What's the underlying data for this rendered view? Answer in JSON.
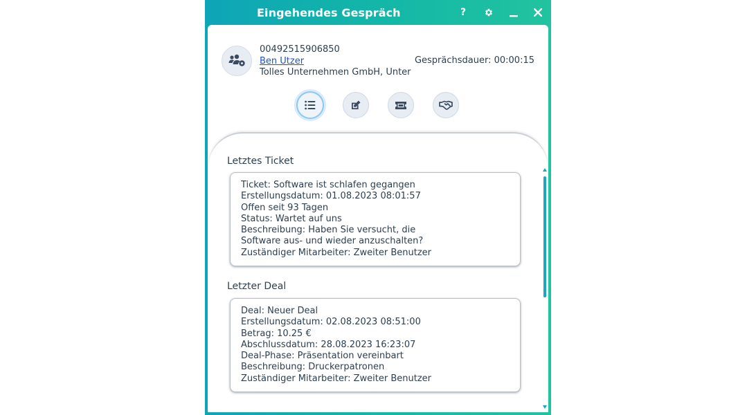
{
  "window": {
    "title": "Eingehendes Gespräch",
    "help_label": "?",
    "minimize_label": "–",
    "close_label": "✕"
  },
  "caller": {
    "phone": "00492515906850",
    "name": "Ben Utzer",
    "company": "Tolles Unternehmen GmbH, Unter",
    "duration": "Gesprächsdauer: 00:00:15"
  },
  "actions": [
    {
      "icon": "list-icon",
      "active": true
    },
    {
      "icon": "edit-icon",
      "active": false
    },
    {
      "icon": "ticket-icon",
      "active": false
    },
    {
      "icon": "handshake-icon",
      "active": false
    }
  ],
  "ticket": {
    "heading": "Letztes Ticket",
    "lines": [
      "Ticket: Software ist schlafen gegangen",
      "Erstellungsdatum: 01.08.2023 08:01:57",
      "Offen seit 93 Tagen",
      "Status: Wartet auf uns",
      "Beschreibung: Haben Sie versucht, die",
      "Software aus- und wieder anzuschalten?",
      "Zuständiger Mitarbeiter: Zweiter Benutzer"
    ]
  },
  "deal": {
    "heading": "Letzter Deal",
    "lines": [
      "Deal: Neuer Deal",
      "Erstellungsdatum: 02.08.2023 08:51:00",
      "Betrag: 10.25 €",
      "Abschlussdatum: 28.08.2023 16:23:07",
      "Deal-Phase: Präsentation vereinbart",
      "Beschreibung: Druckerpatronen",
      "Zuständiger Mitarbeiter: Zweiter Benutzer"
    ]
  },
  "colors": {
    "accent": "#14b8a6",
    "link": "#1a55c9",
    "scrollbar": "#1aa6c7"
  }
}
